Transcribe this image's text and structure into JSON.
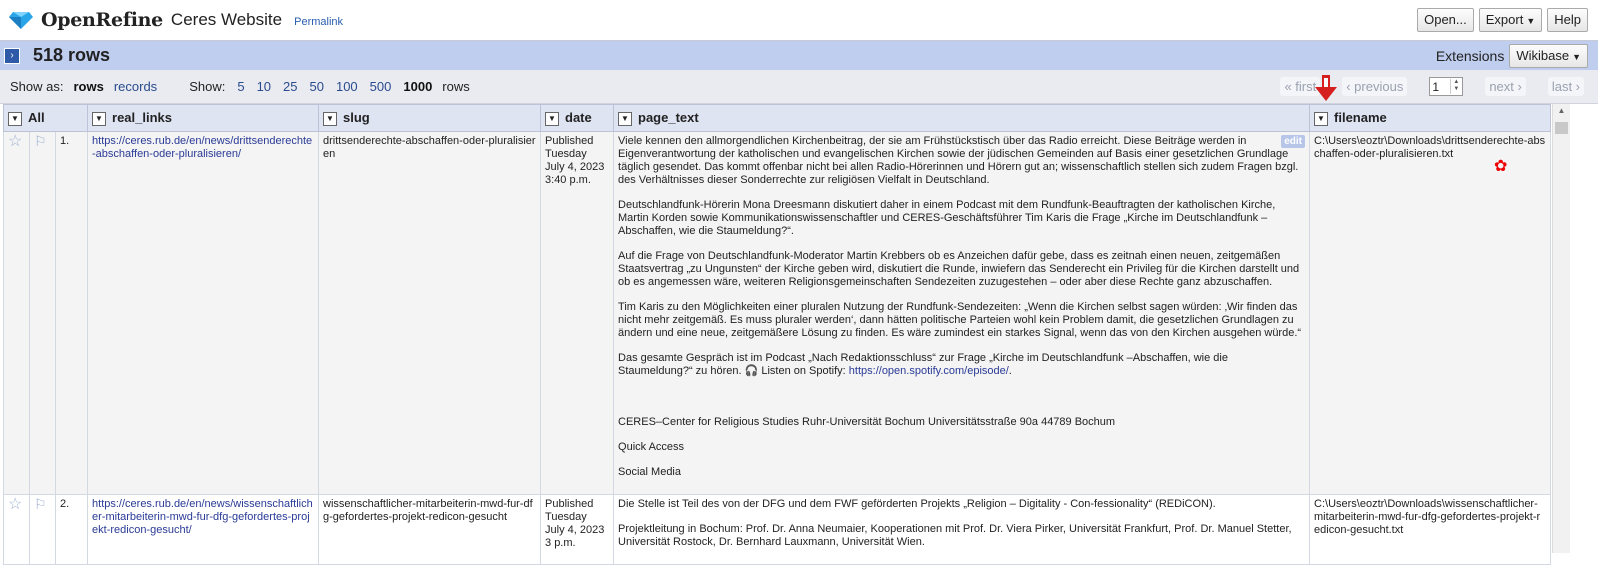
{
  "app": {
    "name": "OpenRefine",
    "project_name": "Ceres Website",
    "permalink": "Permalink"
  },
  "top_buttons": {
    "open": "Open...",
    "export": "Export",
    "help": "Help"
  },
  "summary": {
    "rows_count": "518 rows",
    "extensions_label": "Extensions",
    "wikibase": "Wikibase"
  },
  "view": {
    "show_as_label": "Show as:",
    "rows": "rows",
    "records": "records",
    "show_label": "Show:",
    "sizes": [
      "5",
      "10",
      "25",
      "50",
      "100",
      "500",
      "1000"
    ],
    "rows_word": "rows"
  },
  "pager": {
    "first": "« first",
    "previous": "‹ previous",
    "page": "1",
    "next": "next ›",
    "last": "last ›"
  },
  "columns": [
    "All",
    "real_links",
    "slug",
    "date",
    "page_text",
    "filename"
  ],
  "rows": [
    {
      "index": "1.",
      "real_links": "https://ceres.rub.de/en/news/drittsenderechte-abschaffen-oder-pluralisieren/",
      "slug": "drittsenderechte-abschaffen-oder-pluralisieren",
      "date": [
        "Published",
        "Tuesday",
        "July 4, 2023",
        "3:40 p.m."
      ],
      "edit": "edit",
      "page_text": [
        "Viele kennen den allmorgendlichen Kirchenbeitrag, der sie am Frühstückstisch über das Radio erreicht. Diese Beiträge werden in Eigenverantwortung der katholischen und evangelischen Kirchen sowie der jüdischen Gemeinden auf Basis einer gesetzlichen Grundlage täglich gesendet. Das kommt offenbar nicht bei allen Radio-Hörerinnen und Hörern gut an; wissenschaftlich stellen sich zudem Fragen bzgl. des Verhältnisses dieser Sonderrechte zur religiösen Vielfalt in Deutschland.",
        "Deutschlandfunk-Hörerin Mona Dreesmann diskutiert daher in einem Podcast mit dem Rundfunk-Beauftragten der katholischen Kirche, Martin Korden sowie Kommunikationswissenschaftler und CERES-Geschäftsführer Tim Karis die Frage „Kirche im Deutschlandfunk – Abschaffen, wie die Staumeldung?“.",
        "Auf die Frage von Deutschlandfunk-Moderator Martin Krebbers ob es Anzeichen dafür gebe, dass es zeitnah einen neuen, zeitgemäßen Staatsvertrag „zu Ungunsten“ der Kirche geben wird, diskutiert die Runde, inwiefern das Senderecht ein Privileg für die Kirchen darstellt und ob es angemessen wäre, weiteren Religionsgemeinschaften Sendezeiten zuzugestehen – oder aber diese Rechte ganz abzuschaffen.",
        "Tim Karis zu den Möglichkeiten einer pluralen Nutzung der Rundfunk-Sendezeiten: „Wenn die Kirchen selbst sagen würden: ‚Wir finden das nicht mehr zeitgemäß. Es muss pluraler werden‘, dann hätten politische Parteien wohl kein Problem damit, die gesetzlichen Grundlagen zu ändern und eine neue, zeitgemäßere Lösung zu finden. Es wäre zumindest ein starkes Signal, wenn das von den Kirchen ausgehen würde.“",
        "Das gesamte Gespräch ist im Podcast „Nach Redaktionsschluss“ zur Frage „Kirche im Deutschlandfunk –Abschaffen, wie die Staumeldung?“ zu hören. 🎧 Listen on Spotify: "
      ],
      "spotify_link": "https://open.spotify.com/episode/",
      "page_text_tail": [
        "CERES–Center for Religious Studies Ruhr-Universität Bochum Universitätsstraße 90a 44789 Bochum",
        "Quick Access",
        "Social Media"
      ],
      "filename": "C:\\Users\\eoztr\\Downloads\\drittsenderechte-abschaffen-oder-pluralisieren.txt"
    },
    {
      "index": "2.",
      "real_links": "https://ceres.rub.de/en/news/wissenschaftlicher-mitarbeiterin-mwd-fur-dfg-gefordertes-projekt-redicon-gesucht/",
      "slug": "wissenschaftlicher-mitarbeiterin-mwd-fur-dfg-gefordertes-projekt-redicon-gesucht",
      "date": [
        "Published",
        "Tuesday",
        "July 4, 2023",
        "3 p.m."
      ],
      "page_text": [
        "Die Stelle ist Teil des von der DFG und dem FWF geförderten Projekts „Religion – Digitality - Con-fessionality“ (REDiCON).",
        "Projektleitung in Bochum: Prof. Dr. Anna Neumaier, Kooperationen mit Prof. Dr. Viera Pirker, Universität Frankfurt, Prof. Dr. Manuel Stetter, Universität Rostock, Dr. Bernhard Lauxmann, Universität Wien."
      ],
      "filename": "C:\\Users\\eoztr\\Downloads\\wissenschaftlicher-mitarbeiterin-mwd-fur-dfg-gefordertes-projekt-redicon-gesucht.txt"
    }
  ]
}
